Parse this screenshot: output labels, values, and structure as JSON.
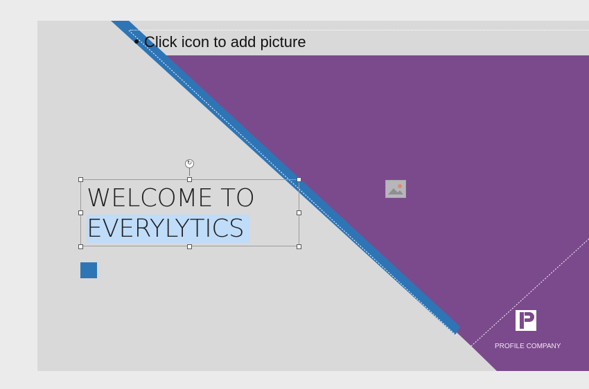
{
  "slide": {
    "picture_placeholder": {
      "prompt": "Click icon to add picture",
      "icon": "picture-icon"
    },
    "title": {
      "line1": "WELCOME TO",
      "line2": "EVERYLYTICS"
    },
    "logo": {
      "mark": "P",
      "label": "PROFILE COMPANY"
    }
  },
  "colors": {
    "slide_background": "#d9d9d9",
    "purple_shape": "#7b4a8c",
    "blue_stripe": "#2e75b6",
    "selection_highlight": "#bfdcf8"
  }
}
